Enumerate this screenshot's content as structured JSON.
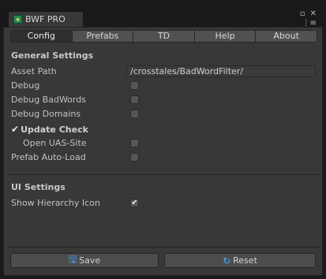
{
  "window": {
    "tab_title": "BWF PRO",
    "logo_glyph": "✱",
    "restore_glyph": "▫",
    "close_glyph": "✕",
    "menu_glyph": "⋮≡"
  },
  "toolbar": {
    "tabs": [
      "Config",
      "Prefabs",
      "TD",
      "Help",
      "About"
    ],
    "active": "Config"
  },
  "general": {
    "title": "General Settings",
    "asset_path_label": "Asset Path",
    "asset_path_value": "/crosstales/BadWordFilter/",
    "debug_label": "Debug",
    "debug_badwords_label": "Debug BadWords",
    "debug_domains_label": "Debug Domains",
    "update_check_label": "Update Check",
    "update_check_mark": "✔",
    "open_uas_label": "Open UAS-Site",
    "prefab_autoload_label": "Prefab Auto-Load",
    "debug_checked": false,
    "debug_badwords_checked": false,
    "debug_domains_checked": false,
    "update_check_checked": true,
    "open_uas_checked": false,
    "prefab_autoload_checked": false
  },
  "ui_settings": {
    "title": "UI Settings",
    "show_hierarchy_label": "Show Hierarchy Icon",
    "show_hierarchy_checked": true,
    "check_glyph": "✔"
  },
  "buttons": {
    "save_label": "Save",
    "save_icon_glyph": "🖫",
    "reset_label": "Reset",
    "reset_icon_glyph": "↻"
  },
  "colors": {
    "panel_bg": "#383838",
    "accent_icon": "#4aa3ff"
  }
}
